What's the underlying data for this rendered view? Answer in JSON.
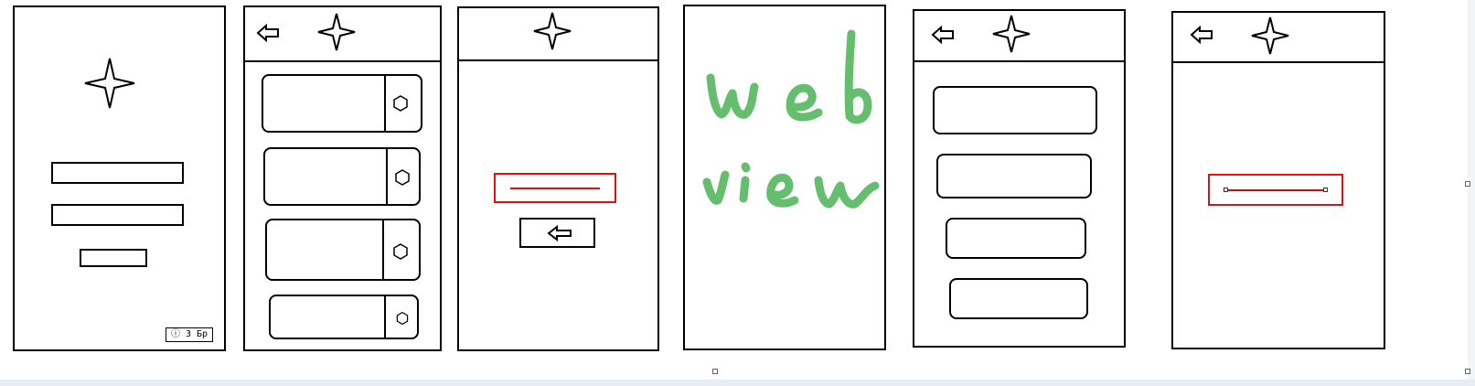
{
  "wireframes": {
    "login": {
      "tiny_text": "ⓘ 3 Бр"
    },
    "webview": {
      "line1": "web",
      "line2": "view"
    }
  },
  "icons": {
    "star": "four-point-star-icon",
    "back": "back-arrow-icon",
    "hex": "hexagon-icon"
  },
  "colors": {
    "ink": "#000000",
    "selection_red": "#e01010",
    "scribble_green": "#3fae49"
  }
}
